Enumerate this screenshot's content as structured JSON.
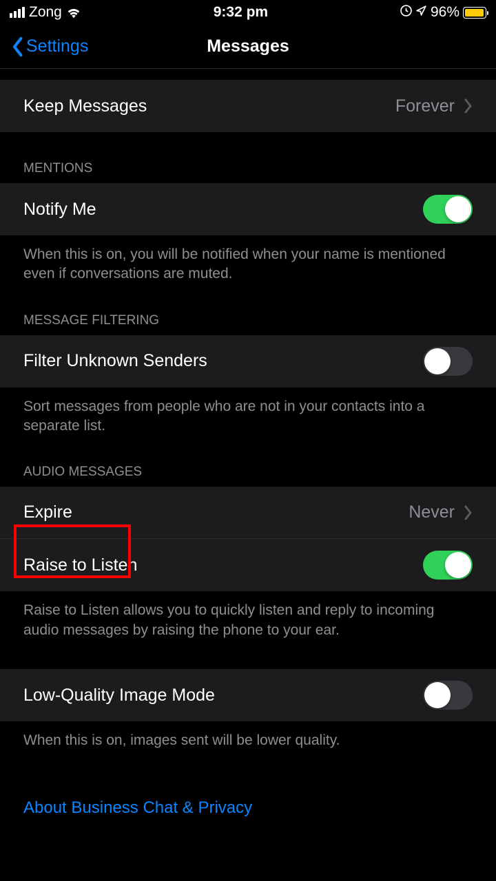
{
  "status": {
    "carrier": "Zong",
    "time": "9:32 pm",
    "battery_pct": "96%",
    "battery_fill_pct": 96
  },
  "header": {
    "back": "Settings",
    "title": "Messages"
  },
  "keep_messages": {
    "label": "Keep Messages",
    "value": "Forever"
  },
  "mentions": {
    "header": "MENTIONS",
    "notify_label": "Notify Me",
    "notify_on": true,
    "footer": "When this is on, you will be notified when your name is mentioned even if conversations are muted."
  },
  "filtering": {
    "header": "MESSAGE FILTERING",
    "filter_label": "Filter Unknown Senders",
    "filter_on": false,
    "footer": "Sort messages from people who are not in your contacts into a separate list."
  },
  "audio": {
    "header": "AUDIO MESSAGES",
    "expire_label": "Expire",
    "expire_value": "Never",
    "raise_label": "Raise to Listen",
    "raise_on": true,
    "footer": "Raise to Listen allows you to quickly listen and reply to incoming audio messages by raising the phone to your ear."
  },
  "low_quality": {
    "label": "Low-Quality Image Mode",
    "on": false,
    "footer": "When this is on, images sent will be lower quality."
  },
  "about_link": "About Business Chat & Privacy"
}
